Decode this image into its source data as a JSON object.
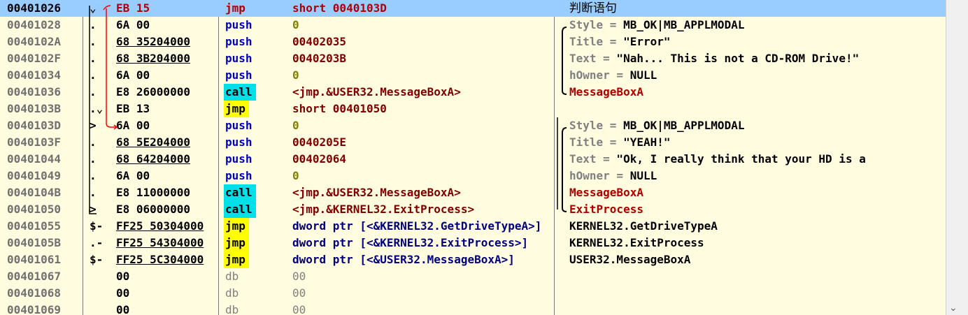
{
  "rows": [
    {
      "addr": "00401026",
      "mark": "⌄",
      "hex": "EB 15",
      "mnem": "jmp",
      "mtype": "jmp-sel",
      "ops": "short 0040103D",
      "comment": "判断语句",
      "ctype": "plain"
    },
    {
      "addr": "00401028",
      "mark": ".",
      "hex": "6A 00",
      "mnem": "push",
      "mtype": "push",
      "ops": "0",
      "comment": "Style = MB_OK|MB_APPLMODAL",
      "ctype": "param"
    },
    {
      "addr": "0040102A",
      "mark": ".",
      "hex": "68 35204000",
      "mnem": "push",
      "mtype": "push",
      "ops": "00402035",
      "comment": "Title = \"Error\"",
      "ctype": "param"
    },
    {
      "addr": "0040102F",
      "mark": ".",
      "hex": "68 3B204000",
      "mnem": "push",
      "mtype": "push",
      "ops": "0040203B",
      "comment": "Text = \"Nah... This is not a CD-ROM Drive!\"",
      "ctype": "param"
    },
    {
      "addr": "00401034",
      "mark": ".",
      "hex": "6A 00",
      "mnem": "push",
      "mtype": "push",
      "ops": "0",
      "comment": "hOwner = NULL",
      "ctype": "param"
    },
    {
      "addr": "00401036",
      "mark": ".",
      "hex": "E8 26000000",
      "mnem": "call",
      "mtype": "call",
      "ops": "<jmp.&USER32.MessageBoxA>",
      "comment": "MessageBoxA",
      "ctype": "func"
    },
    {
      "addr": "0040103B",
      "mark": ".⌄",
      "hex": "EB 13",
      "mnem": "jmp",
      "mtype": "jmp",
      "ops": "short 00401050",
      "comment": "",
      "ctype": "plain"
    },
    {
      "addr": "0040103D",
      "mark": ">",
      "hex": "6A 00",
      "mnem": "push",
      "mtype": "push",
      "ops": "0",
      "comment": "Style = MB_OK|MB_APPLMODAL",
      "ctype": "param"
    },
    {
      "addr": "0040103F",
      "mark": ".",
      "hex": "68 5E204000",
      "mnem": "push",
      "mtype": "push",
      "ops": "0040205E",
      "comment": "Title = \"YEAH!\"",
      "ctype": "param"
    },
    {
      "addr": "00401044",
      "mark": ".",
      "hex": "68 64204000",
      "mnem": "push",
      "mtype": "push",
      "ops": "00402064",
      "comment": "Text = \"Ok, I really think that your HD is a",
      "ctype": "param"
    },
    {
      "addr": "00401049",
      "mark": ".",
      "hex": "6A 00",
      "mnem": "push",
      "mtype": "push",
      "ops": "0",
      "comment": "hOwner = NULL",
      "ctype": "param"
    },
    {
      "addr": "0040104B",
      "mark": ".",
      "hex": "E8 11000000",
      "mnem": "call",
      "mtype": "call",
      "ops": "<jmp.&USER32.MessageBoxA>",
      "comment": "MessageBoxA",
      "ctype": "func"
    },
    {
      "addr": "00401050",
      "mark": ">",
      "hex": "E8 06000000",
      "mnem": "call",
      "mtype": "call",
      "ops": "<jmp.&KERNEL32.ExitProcess>",
      "comment": "ExitProcess",
      "ctype": "func"
    },
    {
      "addr": "00401055",
      "mark": "$-",
      "hex": "FF25 50304000",
      "mnem": "jmp",
      "mtype": "jmp",
      "ops": "dword ptr [<&KERNEL32.GetDriveTypeA>]",
      "comment": "KERNEL32.GetDriveTypeA",
      "ctype": "plain"
    },
    {
      "addr": "0040105B",
      "mark": ".-",
      "hex": "FF25 54304000",
      "mnem": "jmp",
      "mtype": "jmp",
      "ops": "dword ptr [<&KERNEL32.ExitProcess>]",
      "comment": "KERNEL32.ExitProcess",
      "ctype": "plain"
    },
    {
      "addr": "00401061",
      "mark": "$-",
      "hex": "FF25 5C304000",
      "mnem": "jmp",
      "mtype": "jmp",
      "ops": "dword ptr [<&USER32.MessageBoxA>]",
      "comment": "USER32.MessageBoxA",
      "ctype": "plain"
    },
    {
      "addr": "00401067",
      "mark": "",
      "hex": "00",
      "mnem": "db",
      "mtype": "db",
      "ops": "00",
      "comment": "",
      "ctype": "plain"
    },
    {
      "addr": "00401068",
      "mark": "",
      "hex": "00",
      "mnem": "db",
      "mtype": "db",
      "ops": "00",
      "comment": "",
      "ctype": "plain"
    },
    {
      "addr": "00401069",
      "mark": "",
      "hex": "00",
      "mnem": "db",
      "mtype": "db",
      "ops": "00",
      "comment": "",
      "ctype": "plain"
    }
  ],
  "scrollbar": {
    "down_icon": "chevron-down-icon",
    "down_glyph": "⌄"
  },
  "colors": {
    "background": "#fffce0",
    "selection": "#99ccff",
    "call_highlight": "#00e0e8",
    "jmp_highlight": "#ffff00",
    "jump_arrow": "#ff0000",
    "api_name": "#ff0000"
  }
}
